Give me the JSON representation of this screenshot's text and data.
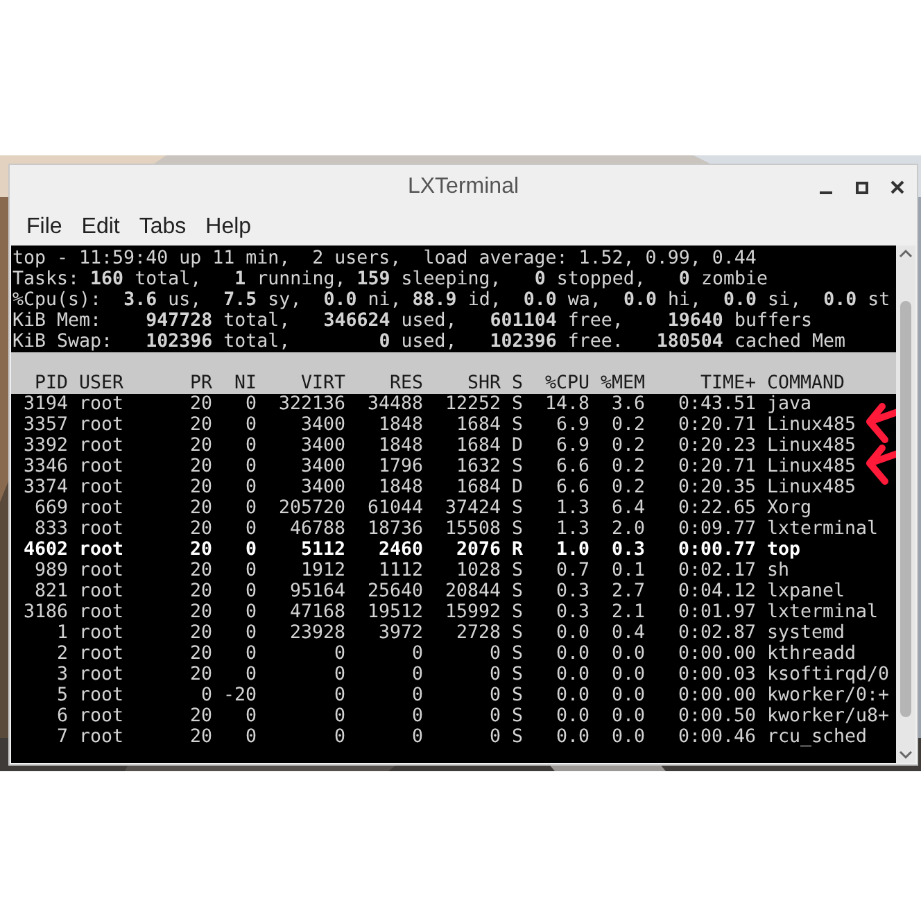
{
  "window": {
    "title": "LXTerminal"
  },
  "menu": [
    "File",
    "Edit",
    "Tabs",
    "Help"
  ],
  "summary_lines": [
    "top - 11:59:40 up 11 min,  2 users,  load average: 1.52, 0.99, 0.44",
    "Tasks: **160** total,   **1** running, **159** sleeping,   **0** stopped,   **0** zombie",
    "%Cpu(s):  **3.6** us,  **7.5** sy,  **0.0** ni, **88.9** id,  **0.0** wa,  **0.0** hi,  **0.0** si,  **0.0** st",
    "KiB Mem:    **947728** total,   **346624** used,   **601104** free,    **19640** buffers",
    "KiB Swap:   **102396** total,        **0** used,   **102396** free.   **180504** cached Mem"
  ],
  "table": {
    "columns": [
      "PID",
      "USER",
      "PR",
      "NI",
      "VIRT",
      "RES",
      "SHR",
      "S",
      "%CPU",
      "%MEM",
      "TIME+",
      "COMMAND"
    ],
    "rows": [
      {
        "cells": [
          "3194",
          "root",
          "20",
          "0",
          "322136",
          "34488",
          "12252",
          "S",
          "14.8",
          "3.6",
          "0:43.51",
          "java"
        ],
        "highlighted": false,
        "arrow": false
      },
      {
        "cells": [
          "3357",
          "root",
          "20",
          "0",
          "3400",
          "1848",
          "1684",
          "S",
          "6.9",
          "0.2",
          "0:20.71",
          "Linux485"
        ],
        "highlighted": false,
        "arrow": true
      },
      {
        "cells": [
          "3392",
          "root",
          "20",
          "0",
          "3400",
          "1848",
          "1684",
          "D",
          "6.9",
          "0.2",
          "0:20.23",
          "Linux485"
        ],
        "highlighted": false,
        "arrow": false
      },
      {
        "cells": [
          "3346",
          "root",
          "20",
          "0",
          "3400",
          "1796",
          "1632",
          "S",
          "6.6",
          "0.2",
          "0:20.71",
          "Linux485"
        ],
        "highlighted": false,
        "arrow": true
      },
      {
        "cells": [
          "3374",
          "root",
          "20",
          "0",
          "3400",
          "1848",
          "1684",
          "D",
          "6.6",
          "0.2",
          "0:20.35",
          "Linux485"
        ],
        "highlighted": false,
        "arrow": false
      },
      {
        "cells": [
          "669",
          "root",
          "20",
          "0",
          "205720",
          "61044",
          "37424",
          "S",
          "1.3",
          "6.4",
          "0:22.65",
          "Xorg"
        ],
        "highlighted": false,
        "arrow": false
      },
      {
        "cells": [
          "833",
          "root",
          "20",
          "0",
          "46788",
          "18736",
          "15508",
          "S",
          "1.3",
          "2.0",
          "0:09.77",
          "lxterminal"
        ],
        "highlighted": false,
        "arrow": false
      },
      {
        "cells": [
          "4602",
          "root",
          "20",
          "0",
          "5112",
          "2460",
          "2076",
          "R",
          "1.0",
          "0.3",
          "0:00.77",
          "top"
        ],
        "highlighted": true,
        "arrow": false
      },
      {
        "cells": [
          "989",
          "root",
          "20",
          "0",
          "1912",
          "1112",
          "1028",
          "S",
          "0.7",
          "0.1",
          "0:02.17",
          "sh"
        ],
        "highlighted": false,
        "arrow": false
      },
      {
        "cells": [
          "821",
          "root",
          "20",
          "0",
          "95164",
          "25640",
          "20844",
          "S",
          "0.3",
          "2.7",
          "0:04.12",
          "lxpanel"
        ],
        "highlighted": false,
        "arrow": false
      },
      {
        "cells": [
          "3186",
          "root",
          "20",
          "0",
          "47168",
          "19512",
          "15992",
          "S",
          "0.3",
          "2.1",
          "0:01.97",
          "lxterminal"
        ],
        "highlighted": false,
        "arrow": false
      },
      {
        "cells": [
          "1",
          "root",
          "20",
          "0",
          "23928",
          "3972",
          "2728",
          "S",
          "0.0",
          "0.4",
          "0:02.87",
          "systemd"
        ],
        "highlighted": false,
        "arrow": false
      },
      {
        "cells": [
          "2",
          "root",
          "20",
          "0",
          "0",
          "0",
          "0",
          "S",
          "0.0",
          "0.0",
          "0:00.00",
          "kthreadd"
        ],
        "highlighted": false,
        "arrow": false
      },
      {
        "cells": [
          "3",
          "root",
          "20",
          "0",
          "0",
          "0",
          "0",
          "S",
          "0.0",
          "0.0",
          "0:00.03",
          "ksoftirqd/0"
        ],
        "highlighted": false,
        "arrow": false
      },
      {
        "cells": [
          "5",
          "root",
          "0",
          "-20",
          "0",
          "0",
          "0",
          "S",
          "0.0",
          "0.0",
          "0:00.00",
          "kworker/0:+"
        ],
        "highlighted": false,
        "arrow": false
      },
      {
        "cells": [
          "6",
          "root",
          "20",
          "0",
          "0",
          "0",
          "0",
          "S",
          "0.0",
          "0.0",
          "0:00.50",
          "kworker/u8+"
        ],
        "highlighted": false,
        "arrow": false
      },
      {
        "cells": [
          "7",
          "root",
          "20",
          "0",
          "0",
          "0",
          "0",
          "S",
          "0.0",
          "0.0",
          "0:00.46",
          "rcu_sched"
        ],
        "highlighted": false,
        "arrow": false
      }
    ]
  }
}
